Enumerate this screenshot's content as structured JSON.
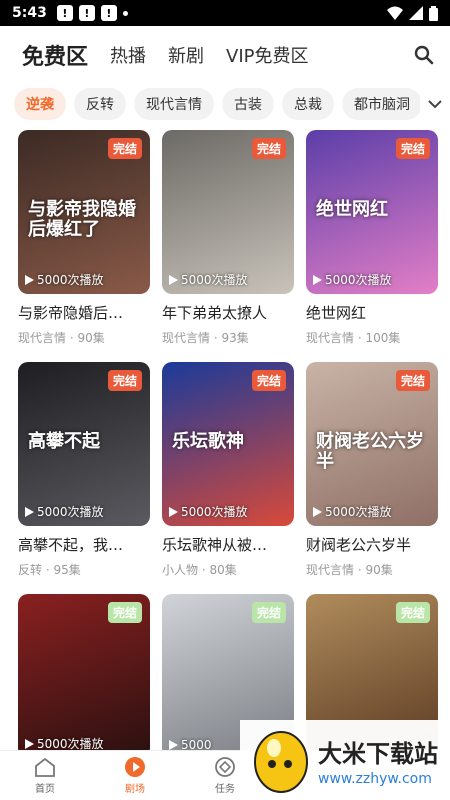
{
  "status": {
    "time": "5:43",
    "notifs": [
      "!",
      "!",
      "!"
    ]
  },
  "top_tabs": [
    {
      "label": "免费区",
      "active": true
    },
    {
      "label": "热播",
      "active": false
    },
    {
      "label": "新剧",
      "active": false
    },
    {
      "label": "VIP免费区",
      "active": false
    }
  ],
  "chips": [
    {
      "label": "逆袭",
      "active": true
    },
    {
      "label": "反转",
      "active": false
    },
    {
      "label": "现代言情",
      "active": false
    },
    {
      "label": "古装",
      "active": false
    },
    {
      "label": "总裁",
      "active": false
    },
    {
      "label": "都市脑洞",
      "active": false
    }
  ],
  "cards": [
    {
      "title": "与影帝隐婚后…",
      "meta": "现代言情 · 90集",
      "badge": "完结",
      "views": "5000次播放",
      "art": "与影帝我隐婚后爆红了",
      "bg": [
        "#3b2a24",
        "#8a5a48"
      ]
    },
    {
      "title": "年下弟弟太撩人",
      "meta": "现代言情 · 93集",
      "badge": "完结",
      "views": "5000次播放",
      "art": "",
      "bg": [
        "#6c6a66",
        "#c9c3ba"
      ]
    },
    {
      "title": "绝世网红",
      "meta": "现代言情 · 100集",
      "badge": "完结",
      "views": "5000次播放",
      "art": "绝世网红",
      "bg": [
        "#5b3ea8",
        "#e37fc7"
      ]
    },
    {
      "title": "高攀不起，我…",
      "meta": "反转 · 95集",
      "badge": "完结",
      "views": "5000次播放",
      "art": "高攀不起",
      "bg": [
        "#1e1e22",
        "#5a5a60"
      ]
    },
    {
      "title": "乐坛歌神从被…",
      "meta": "小人物 · 80集",
      "badge": "完结",
      "views": "5000次播放",
      "art": "乐坛歌神",
      "bg": [
        "#1a3a9a",
        "#d84a3a"
      ]
    },
    {
      "title": "财阀老公六岁半",
      "meta": "现代言情 · 90集",
      "badge": "完结",
      "views": "5000次播放",
      "art": "财阀老公六岁半",
      "bg": [
        "#c8b4a6",
        "#8f6f66"
      ]
    },
    {
      "title": "",
      "meta": "",
      "badge": "完结",
      "views": "5000次播放",
      "art": "",
      "bg": [
        "#8a2020",
        "#2a1010"
      ],
      "green": true
    },
    {
      "title": "",
      "meta": "",
      "badge": "完结",
      "views": "5000",
      "art": "",
      "bg": [
        "#d0d4d8",
        "#7a7e84"
      ],
      "green": true
    },
    {
      "title": "",
      "meta": "",
      "badge": "完结",
      "views": "",
      "art": "",
      "bg": [
        "#b08c5c",
        "#5a3a22"
      ],
      "green": true
    }
  ],
  "bottom_nav": [
    {
      "label": "首页",
      "icon": "home-icon",
      "active": false
    },
    {
      "label": "剧场",
      "icon": "play-icon",
      "active": true
    },
    {
      "label": "任务",
      "icon": "task-icon",
      "active": false
    }
  ],
  "watermark": {
    "title": "大米下载站",
    "url": "www.zzhyw.com"
  },
  "colors": {
    "accent": "#f06a2b",
    "badge": "#e85a3a"
  }
}
